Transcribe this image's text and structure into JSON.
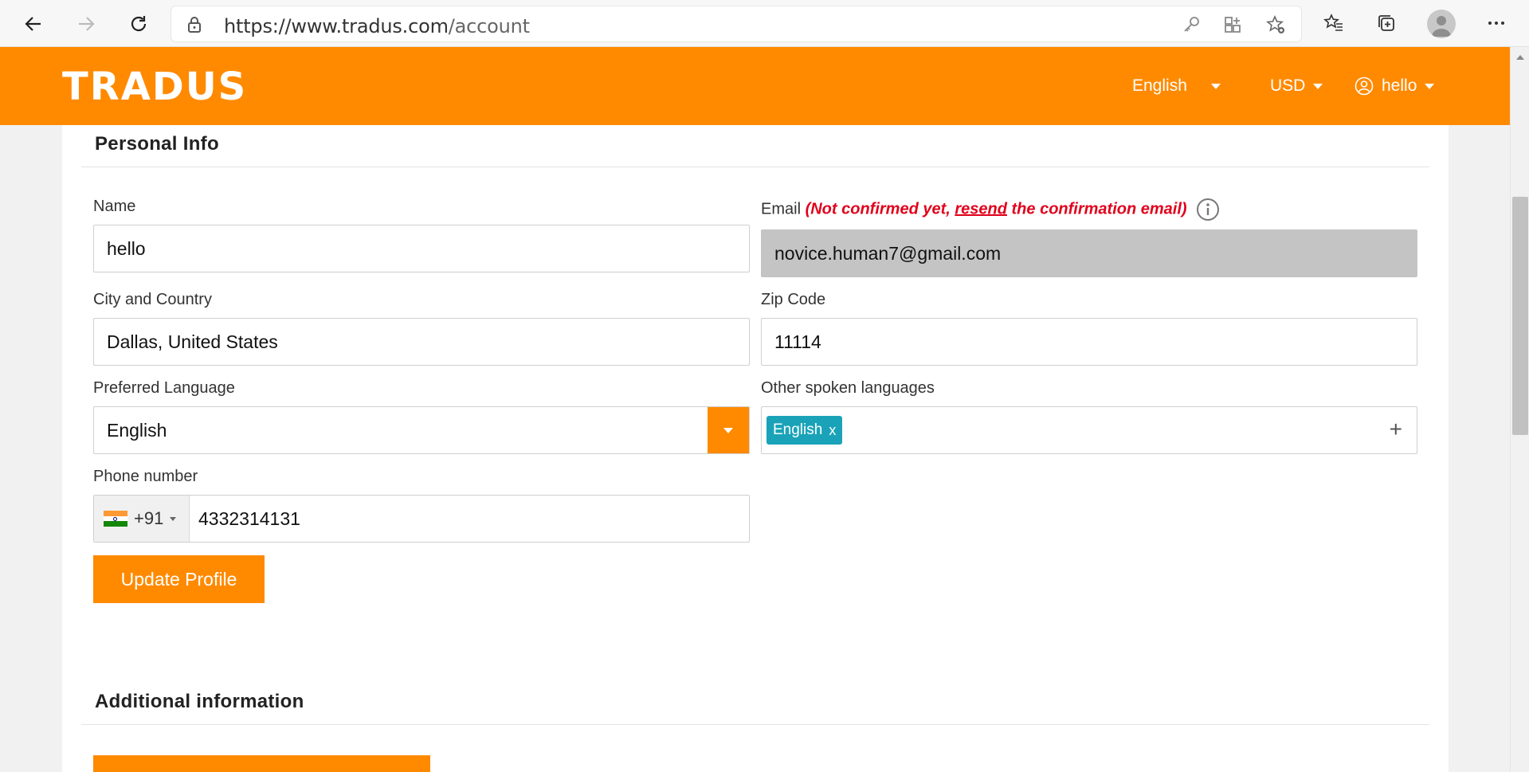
{
  "browser": {
    "url_host": "https://www.tradus.com",
    "url_path": "/account"
  },
  "header": {
    "logo_text": "TRADUS",
    "language": "English",
    "currency": "USD",
    "user": "hello"
  },
  "personal_info": {
    "title": "Personal Info",
    "name_label": "Name",
    "name_value": "hello",
    "email_label": "Email",
    "email_note_prefix": "(Not confirmed yet, ",
    "email_note_link": "resend",
    "email_note_suffix": " the confirmation email)",
    "email_value": "novice.human7@gmail.com",
    "city_label": "City and Country",
    "city_value": "Dallas, United States",
    "zip_label": "Zip Code",
    "zip_value": "11114",
    "pref_lang_label": "Preferred Language",
    "pref_lang_value": "English",
    "other_lang_label": "Other spoken languages",
    "other_lang_tag": "English",
    "other_lang_tag_remove": "x",
    "add_symbol": "+",
    "phone_label": "Phone number",
    "phone_dial_code": "+91",
    "phone_value": "4332314131",
    "update_button": "Update Profile"
  },
  "additional_info": {
    "title": "Additional information"
  },
  "colors": {
    "brand": "#ff8a00",
    "tag": "#1aa3b8",
    "error": "#e0001b"
  }
}
